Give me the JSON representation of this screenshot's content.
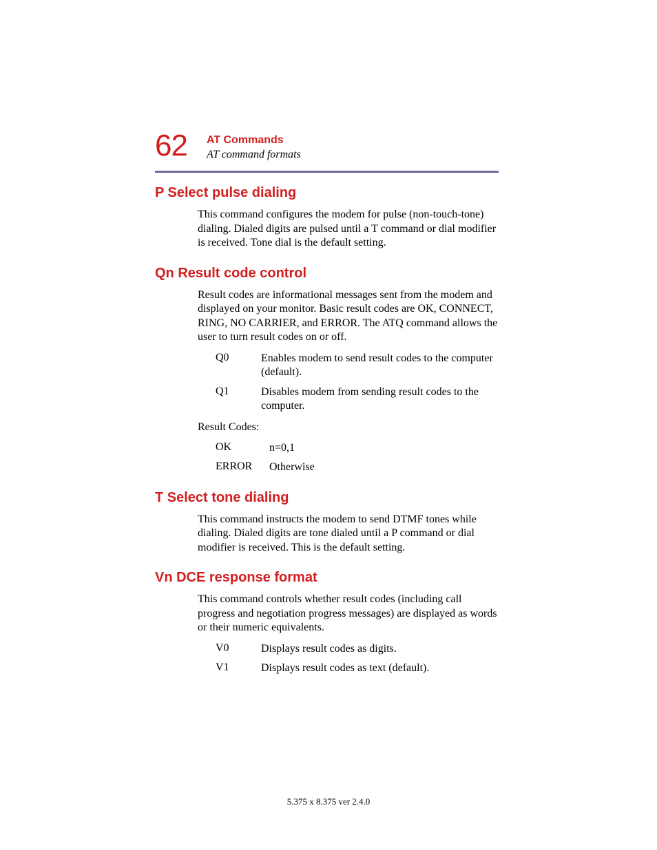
{
  "header": {
    "page_number": "62",
    "chapter_title": "AT Commands",
    "chapter_subtitle": "AT command formats"
  },
  "sections": {
    "p_select": {
      "heading": "P Select pulse dialing",
      "body": "This command configures the modem for pulse (non-touch-tone) dialing. Dialed digits are pulsed until a T command or dial modifier is received. Tone dial is the default setting."
    },
    "qn_result": {
      "heading": "Qn Result code control",
      "body": "Result codes are informational messages sent from the modem and displayed on your monitor. Basic result codes are OK, CONNECT, RING, NO CARRIER, and ERROR. The ATQ command allows the user to turn result codes on or off.",
      "items": [
        {
          "term": "Q0",
          "desc": "Enables modem to send result codes to the computer (default)."
        },
        {
          "term": "Q1",
          "desc": "Disables modem from sending result codes to the computer."
        }
      ],
      "result_codes_label": "Result Codes:",
      "result_codes": [
        {
          "term": "OK",
          "desc": "n=0,1"
        },
        {
          "term": "ERROR",
          "desc": "Otherwise"
        }
      ]
    },
    "t_select": {
      "heading": "T Select tone dialing",
      "body": "This command instructs the modem to send DTMF tones while dialing. Dialed digits are tone dialed until a P command or dial modifier is received. This is the default setting."
    },
    "vn_dce": {
      "heading": "Vn DCE response format",
      "body": "This command controls whether result codes (including call progress and negotiation progress messages) are displayed as words or their numeric equivalents.",
      "items": [
        {
          "term": "V0",
          "desc": "Displays result codes as digits."
        },
        {
          "term": "V1",
          "desc": "Displays result codes as text (default)."
        }
      ]
    }
  },
  "footer": "5.375 x 8.375 ver 2.4.0"
}
